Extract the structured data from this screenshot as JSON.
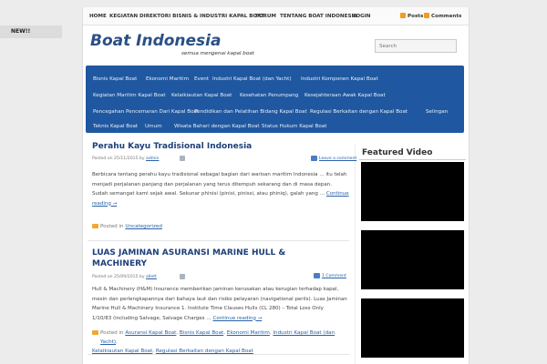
{
  "new_label": "NEW!!",
  "topnav": {
    "items": [
      "Home",
      "Kegiatan",
      "Direktori Bisnis & Industri Kapal Boat",
      "Forum",
      "Tentang Boat Indonesia",
      "Login"
    ],
    "posts": "Posts",
    "comments": "Comments"
  },
  "site": {
    "title": "Boat Indonesia",
    "tagline": "semua mengenai kapal boat"
  },
  "search": {
    "placeholder": "Search"
  },
  "categories": [
    [
      "Bisnis Kapal Boat",
      "Ekonomi Maritim",
      "Event",
      "Industri Kapal Boat (dan Yacht)",
      "Industri Komponen Kapal Boat"
    ],
    [
      "Kegiatan Maritim Kapal Boat",
      "Kelaikiautan Kapal Boat",
      "Kesehatan Penumpang",
      "Kesejahteraan Awak Kapal Boat"
    ],
    [
      "Pencegahan Pencemaran Dari Kapal Boat",
      "Pendidikan dan Pelatihan Bidang Kapal Boat",
      "Regulasi Berkaitan dengan Kapal Boat",
      "Selingan"
    ],
    [
      "Teknis Kapal Boat",
      "Umum",
      "Wisata Bahari dengan Kapal Boat",
      "Status Hukum Kapal Boat"
    ]
  ],
  "posts": [
    {
      "title": "Perahu Kayu Tradisional Indonesia",
      "date_prefix": "Posted on 25/11/2015 by",
      "author": "admin",
      "comment_link": "Leave a comment",
      "body": [
        "Berbicara tentang perahu kayu tradisional sebagai bagian dari warisan maritim Indonesia … itu telah",
        "menjadi perjalanan panjang dan perjalanan yang terus ditempuh sekarang dan di masa depan.",
        "Sudah semangat kami sejak awal. Sekunar phinisi (pinisi, pinissi, atau phiniq), galah yang …"
      ],
      "continue": "Continue",
      "reading": "reading →",
      "posted_in_label": "Posted in",
      "posted_in": [
        "Uncategorized"
      ]
    },
    {
      "title_line1": "LUAS JAMINAN ASURANSI MARINE HULL &",
      "title_line2": "MACHINERY",
      "date_prefix": "Posted on 25/09/2015 by",
      "author": "allett",
      "comment_link": "1 Comment",
      "body": [
        "Hull & Machinery (H&M) Insurance memberikan jaminan kerusakan atau kerugian terhadap kapal,",
        "mesin dan perlengkapannya dari bahaya laut dan risiko pelayaran (navigational perils). Luas Jaminan",
        "Marine Hull & Machinery Insurance 1. Institute Time Clauses Hulls (CL 280) – Total Loss Only",
        "1/10/83 (including Salvage, Salvage Charges …"
      ],
      "continue": "Continue reading →",
      "posted_in_label": "Posted in",
      "posted_in_line1": [
        "Asuransi Kapal Boat",
        "Bisnis Kapal Boat",
        "Ekonomi Maritim",
        "Industri Kapal Boat (dan Yacht)"
      ],
      "posted_in_line2": [
        "Kelaikiautan Kapal Boat",
        "Regulasi Berkaitan dengan Kapal Boat"
      ]
    }
  ],
  "sidebar": {
    "featured_title": "Featured Video"
  },
  "colors": {
    "brand": "#2a4f86",
    "nav": "#1f58a0",
    "link": "#2a62a8"
  }
}
